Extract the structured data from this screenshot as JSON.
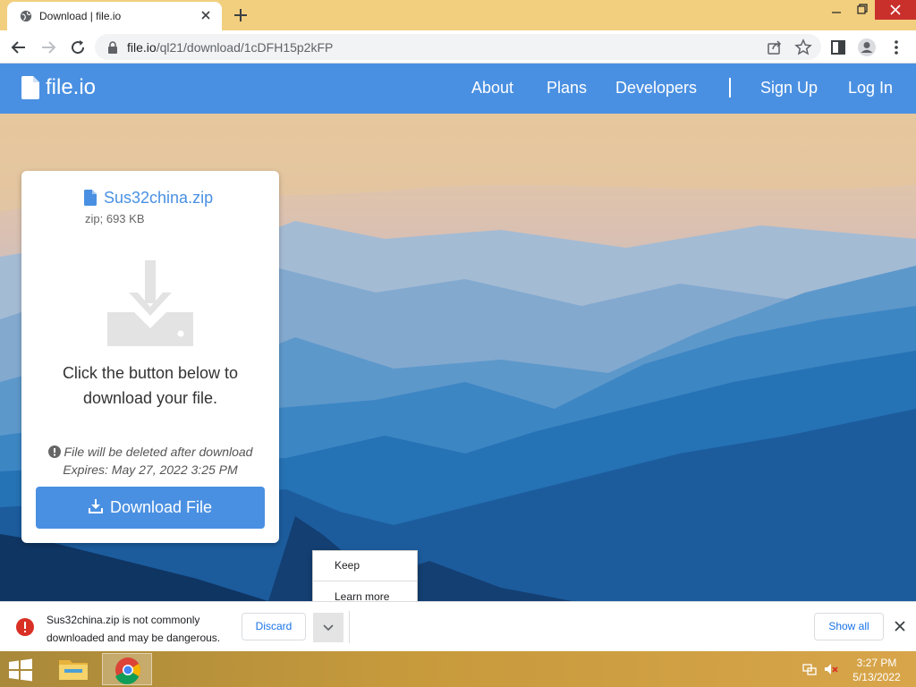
{
  "browser": {
    "tab": {
      "title": "Download | file.io",
      "favicon": "globe-icon"
    },
    "address_bar": {
      "host": "file.io",
      "path": "/ql21/download/1cDFH15p2kFP"
    }
  },
  "site": {
    "logo_text": "file.io",
    "nav": {
      "about": "About",
      "plans": "Plans",
      "developers": "Developers",
      "signup": "Sign Up",
      "login": "Log In"
    },
    "accent_color": "#4a90e2"
  },
  "card": {
    "file_name": "Sus32china.zip",
    "file_meta": "zip; 693 KB",
    "prompt_line1": "Click the button below to",
    "prompt_line2": "download your file.",
    "warning": "File will be deleted after download",
    "expires": "Expires: May 27, 2022 3:25 PM",
    "download_label": "Download File"
  },
  "context_menu": {
    "items": [
      "Keep",
      "Learn more"
    ]
  },
  "download_bar": {
    "message_line1": "Sus32china.zip is not commonly",
    "message_line2": "downloaded and may be dangerous.",
    "discard_label": "Discard",
    "show_all_label": "Show all"
  },
  "taskbar": {
    "time": "3:27 PM",
    "date": "5/13/2022",
    "apps": [
      "file-explorer-icon",
      "chrome-icon"
    ]
  }
}
